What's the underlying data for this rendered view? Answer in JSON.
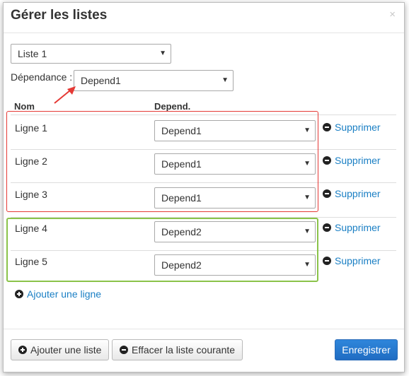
{
  "dialog": {
    "title": "Gérer les listes",
    "close_label": "×"
  },
  "list_select": {
    "value": "Liste 1"
  },
  "dependance": {
    "label": "Dépendance :",
    "value": "Depend1"
  },
  "table": {
    "headers": {
      "name": "Nom",
      "depend": "Depend."
    },
    "rows": [
      {
        "name": "Ligne 1",
        "depend": "Depend1",
        "action": "Supprimer"
      },
      {
        "name": "Ligne 2",
        "depend": "Depend1",
        "action": "Supprimer"
      },
      {
        "name": "Ligne 3",
        "depend": "Depend1",
        "action": "Supprimer"
      },
      {
        "name": "Ligne 4",
        "depend": "Depend2",
        "action": "Supprimer"
      },
      {
        "name": "Ligne 5",
        "depend": "Depend2",
        "action": "Supprimer"
      }
    ]
  },
  "add_row_label": "Ajouter une ligne",
  "footer": {
    "add_list_label": "Ajouter une liste",
    "clear_list_label": "Effacer la liste courante",
    "save_label": "Enregistrer"
  },
  "colors": {
    "link": "#1a7fc4",
    "primary": "#1f6cc2",
    "annotation_red": "#e53935",
    "annotation_green": "#8bc34a"
  }
}
